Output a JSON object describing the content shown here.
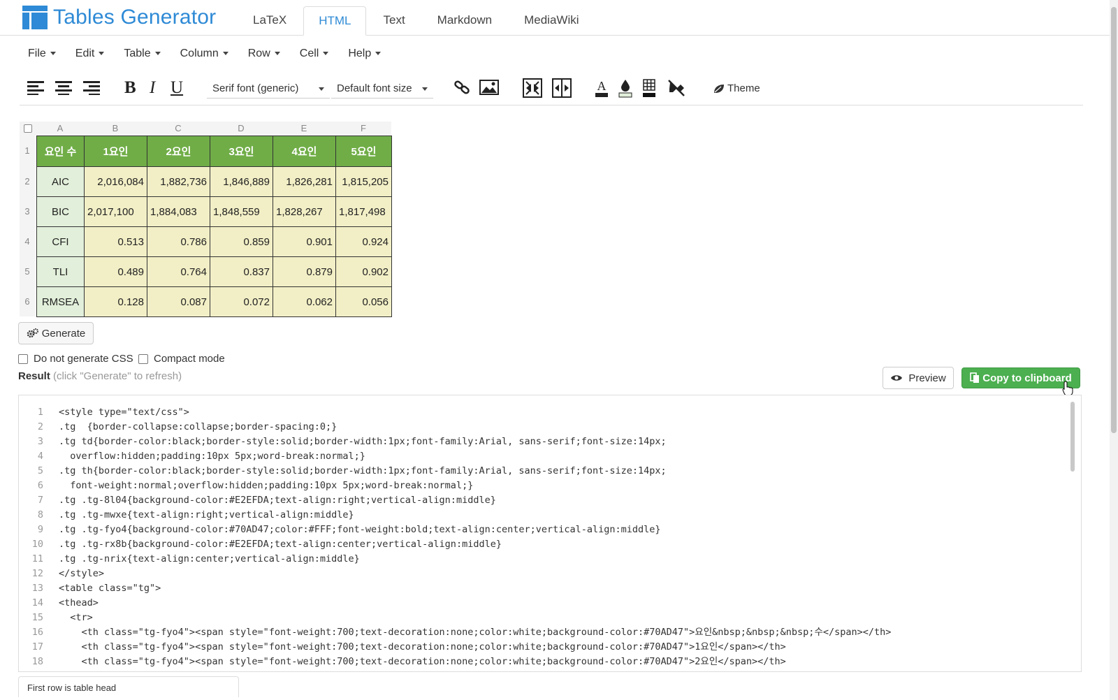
{
  "app": {
    "title": "Tables Generator"
  },
  "nav": {
    "tabs": [
      {
        "label": "LaTeX",
        "active": false
      },
      {
        "label": "HTML",
        "active": true
      },
      {
        "label": "Text",
        "active": false
      },
      {
        "label": "Markdown",
        "active": false
      },
      {
        "label": "MediaWiki",
        "active": false
      }
    ]
  },
  "menu": {
    "items": [
      "File",
      "Edit",
      "Table",
      "Column",
      "Row",
      "Cell",
      "Help"
    ]
  },
  "toolbar": {
    "bold": "B",
    "italic": "I",
    "underline": "U",
    "font_family": "Serif font (generic)",
    "font_size": "Default font size",
    "theme_label": "Theme"
  },
  "colors": {
    "header_green": "#70AD47",
    "row_label_bg": "#E2EFDA",
    "cell_bg": "#F2EFC6",
    "copy_button": "#4CAF50",
    "brand_blue": "#2E8AD6"
  },
  "grid": {
    "columns": [
      "A",
      "B",
      "C",
      "D",
      "E",
      "F"
    ],
    "rows": [
      "1",
      "2",
      "3",
      "4",
      "5",
      "6"
    ],
    "header": [
      "요인  수",
      "1요인",
      "2요인",
      "3요인",
      "4요인",
      "5요인"
    ],
    "body": [
      [
        "AIC",
        "2,016,084",
        "1,882,736",
        "1,846,889",
        "1,826,281",
        "1,815,205"
      ],
      [
        "BIC",
        "2,017,100",
        "1,884,083",
        "1,848,559",
        "1,828,267",
        "1,817,498"
      ],
      [
        "CFI",
        "0.513",
        "0.786",
        "0.859",
        "0.901",
        "0.924"
      ],
      [
        "TLI",
        "0.489",
        "0.764",
        "0.837",
        "0.879",
        "0.902"
      ],
      [
        "RMSEA",
        "0.128",
        "0.087",
        "0.072",
        "0.062",
        "0.056"
      ]
    ]
  },
  "actions": {
    "generate": "Generate",
    "no_css": "Do not generate CSS",
    "compact": "Compact mode",
    "result_label": "Result",
    "result_hint": "(click \"Generate\" to refresh)",
    "preview": "Preview",
    "copy": "Copy to clipboard"
  },
  "code": {
    "lines": [
      "<style type=\"text/css\">",
      ".tg  {border-collapse:collapse;border-spacing:0;}",
      ".tg td{border-color:black;border-style:solid;border-width:1px;font-family:Arial, sans-serif;font-size:14px;",
      "  overflow:hidden;padding:10px 5px;word-break:normal;}",
      ".tg th{border-color:black;border-style:solid;border-width:1px;font-family:Arial, sans-serif;font-size:14px;",
      "  font-weight:normal;overflow:hidden;padding:10px 5px;word-break:normal;}",
      ".tg .tg-8l04{background-color:#E2EFDA;text-align:right;vertical-align:middle}",
      ".tg .tg-mwxe{text-align:right;vertical-align:middle}",
      ".tg .tg-fyo4{background-color:#70AD47;color:#FFF;font-weight:bold;text-align:center;vertical-align:middle}",
      ".tg .tg-rx8b{background-color:#E2EFDA;text-align:center;vertical-align:middle}",
      ".tg .tg-nrix{text-align:center;vertical-align:middle}",
      "</style>",
      "<table class=\"tg\">",
      "<thead>",
      "  <tr>",
      "    <th class=\"tg-fyo4\"><span style=\"font-weight:700;text-decoration:none;color:white;background-color:#70AD47\">요인&nbsp;&nbsp;&nbsp;수</span></th>",
      "    <th class=\"tg-fyo4\"><span style=\"font-weight:700;text-decoration:none;color:white;background-color:#70AD47\">1요인</span></th>",
      "    <th class=\"tg-fyo4\"><span style=\"font-weight:700;text-decoration:none;color:white;background-color:#70AD47\">2요인</span></th>"
    ]
  },
  "footer": {
    "stub": "First row is table head"
  }
}
